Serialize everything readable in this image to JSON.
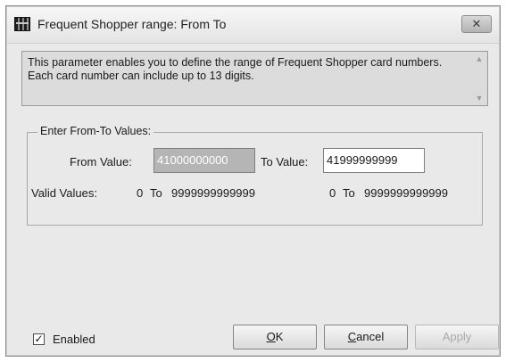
{
  "window": {
    "title": "Frequent Shopper range: From To",
    "close_glyph": "✕"
  },
  "description": {
    "text": "This parameter enables you to define the range of Frequent Shopper card numbers. Each card number can include up to 13 digits.",
    "scroll_up": "▲",
    "scroll_down": "▼"
  },
  "range_group": {
    "legend": "Enter From-To Values:",
    "from_label": "From Value:",
    "from_value": "41000000000",
    "to_label": "To Value:",
    "to_value": "41999999999",
    "valid_label": "Valid Values:",
    "valid_from_min": "0",
    "valid_from_to": "To",
    "valid_from_max": "9999999999999",
    "valid_to_min": "0",
    "valid_to_to": "To",
    "valid_to_max": "9999999999999"
  },
  "footer": {
    "enabled_checked": true,
    "enabled_mark": "✓",
    "enabled_label": "Enabled",
    "ok_mnemonic": "O",
    "ok_rest": "K",
    "cancel_mnemonic": "C",
    "cancel_rest": "ancel",
    "apply_label": "Apply"
  }
}
